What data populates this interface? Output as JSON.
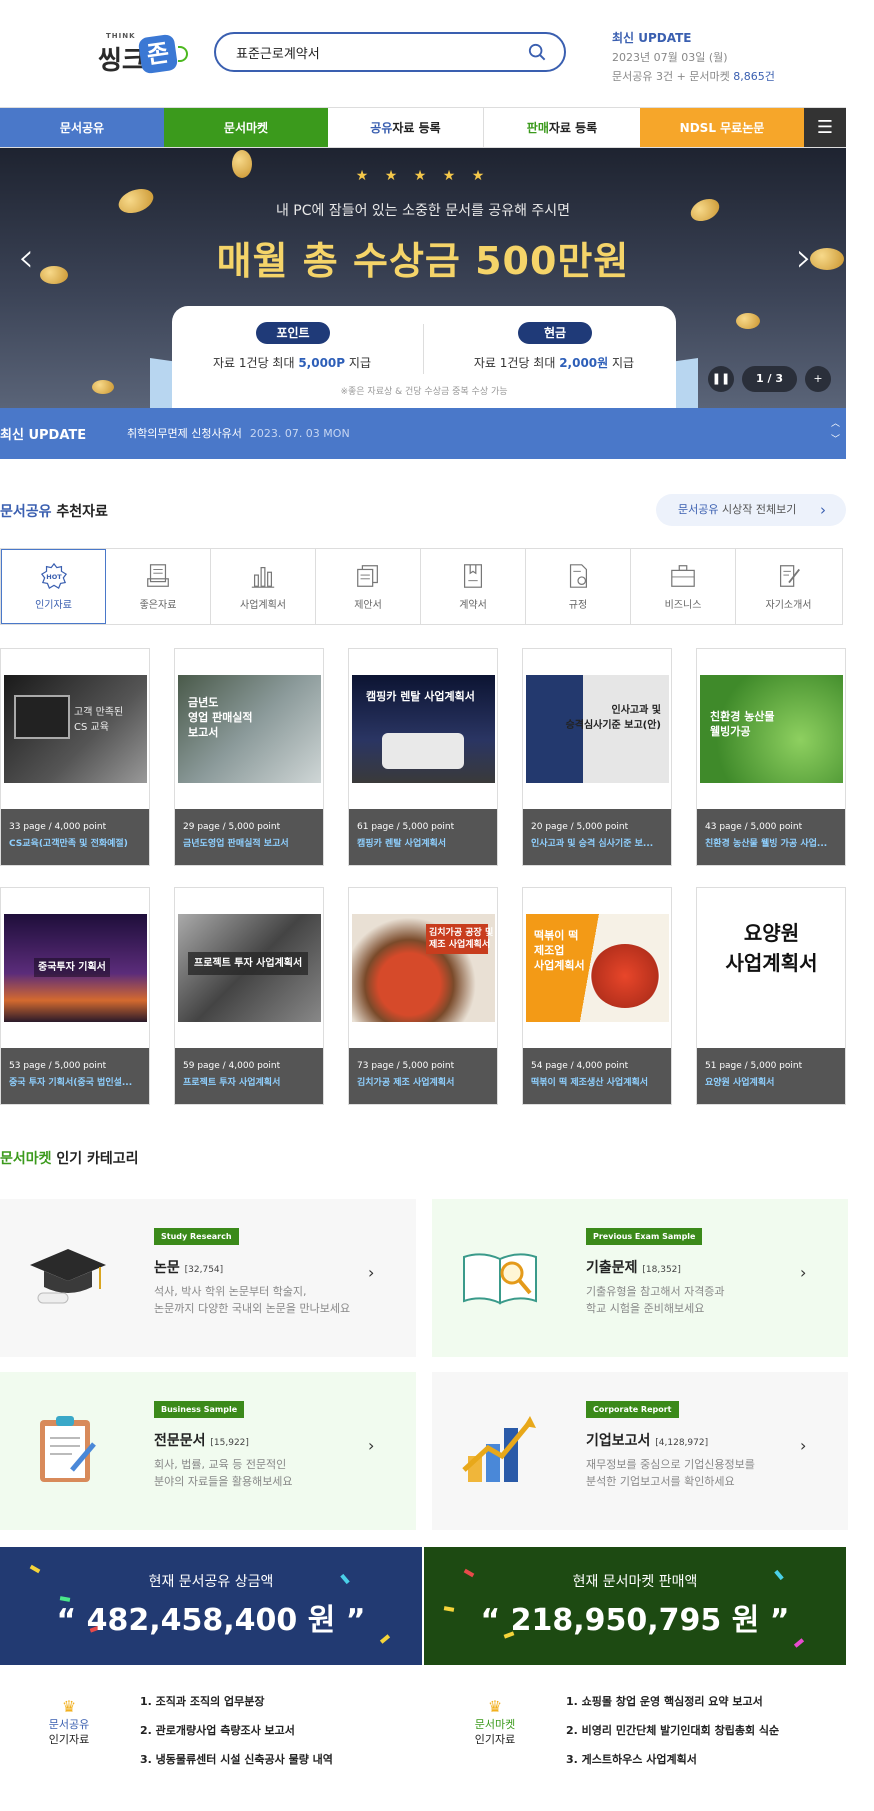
{
  "header": {
    "logo_small": "THINK",
    "logo_main": "씽크",
    "logo_badge": "존",
    "search_value": "표준근로계약서",
    "update_title": "최신 UPDATE",
    "update_date": "2023년 07월 03일 (월)",
    "update_count_prefix": "문서공유 3건 + 문서마켓 ",
    "update_count_value": "8,865건"
  },
  "nav": {
    "n1": "문서공유",
    "n2": "문서마켓",
    "n3_accent": "공유",
    "n3_rest": "자료 등록",
    "n4_accent": "판매",
    "n4_rest": "자료 등록",
    "n5": "NDSL 무료논문",
    "menu_icon": "hamburger-icon"
  },
  "banner": {
    "stars": "★ ★ ★ ★ ★",
    "subtitle": "내 PC에 잠들어 있는 소중한 문서를 공유해 주시면",
    "headline": "매월 총 수상금 500만원",
    "left_pill": "포인트",
    "left_text_a": "자료 1건당 최대 ",
    "left_text_b": "5,000P",
    "left_text_c": " 지급",
    "right_pill": "현금",
    "right_text_a": "자료 1건당 최대 ",
    "right_text_b": "2,000원",
    "right_text_c": " 지급",
    "note": "※좋은 자료상 & 건당 수상금 중복 수상 가능",
    "page": "1 / 3",
    "pause": "❚❚",
    "plus": "+"
  },
  "update_bar": {
    "title": "최신 UPDATE",
    "item": "취학의무면제 신청사유서",
    "date": "2023. 07. 03 MON"
  },
  "recommend": {
    "title_accent": "문서공유",
    "title_rest": " 추천자료",
    "viewall_accent": "문서공유",
    "viewall_rest": " 시상작 전체보기",
    "tabs": [
      {
        "label": "인기자료",
        "icon": "hot-badge-icon"
      },
      {
        "label": "좋은자료",
        "icon": "document-tray-icon"
      },
      {
        "label": "사업계획서",
        "icon": "bar-chart-icon"
      },
      {
        "label": "제안서",
        "icon": "papers-icon"
      },
      {
        "label": "계약서",
        "icon": "contract-book-icon"
      },
      {
        "label": "규정",
        "icon": "regulation-doc-icon"
      },
      {
        "label": "비즈니스",
        "icon": "briefcase-icon"
      },
      {
        "label": "자기소개서",
        "icon": "pen-doc-icon"
      }
    ],
    "docs": [
      {
        "thumb": "고객 만족된\nCS 교육",
        "meta": "33 page / 4,000 point",
        "name": "CS교육(고객만족 및 전화예절)"
      },
      {
        "thumb": "금년도\n영업 판매실적\n보고서",
        "meta": "29 page / 5,000 point",
        "name": "금년도영업 판매실적 보고서"
      },
      {
        "thumb": "캠핑카 렌탈 사업계획서",
        "meta": "61 page / 5,000 point",
        "name": "캠핑카 렌탈 사업계획서"
      },
      {
        "thumb": "인사고과 및\n승격심사기준 보고(안)",
        "meta": "20 page / 5,000 point",
        "name": "인사고과 및 승격 심사기준 보..."
      },
      {
        "thumb": "친환경 농산물\n웰빙가공",
        "meta": "43 page / 5,000 point",
        "name": "친환경 농산물 웰빙 가공 사업..."
      },
      {
        "thumb": "중국투자 기획서",
        "meta": "53 page / 5,000 point",
        "name": "중국 투자 기획서(중국 법인설..."
      },
      {
        "thumb": "프로젝트 투자 사업계획서",
        "meta": "59 page / 4,000 point",
        "name": "프로젝트 투자 사업계획서"
      },
      {
        "thumb": "김치가공 공장 및\n제조 사업계획서",
        "meta": "73 page / 5,000 point",
        "name": "김치가공 제조 사업계획서"
      },
      {
        "thumb": "떡볶이 떡\n제조업\n사업계획서",
        "meta": "54 page / 4,000 point",
        "name": "떡볶이 떡 제조생산 사업계획서"
      },
      {
        "thumb": "요양원\n사업계획서",
        "meta": "51 page / 5,000 point",
        "name": "요양원 사업계획서"
      }
    ]
  },
  "market": {
    "title_accent": "문서마켓",
    "title_rest": " 인기 카테고리",
    "cards": [
      {
        "badge": "Study Research",
        "name": "논문",
        "count": "[32,754]",
        "desc1": "석사, 박사 학위 논문부터 학술지,",
        "desc2": "논문까지 다양한 국내외 논문을 만나보세요",
        "icon": "graduation-cap-icon",
        "bg": "#f7f7f7"
      },
      {
        "badge": "Previous Exam Sample",
        "name": "기출문제",
        "count": "[18,352]",
        "desc1": "기출유형을 참고해서 자격증과",
        "desc2": "학교 시험을 준비해보세요",
        "icon": "book-magnifier-icon",
        "bg": "#f1fbef"
      },
      {
        "badge": "Business Sample",
        "name": "전문문서",
        "count": "[15,922]",
        "desc1": "회사, 법률, 교육 등 전문적인",
        "desc2": "분야의 자료들을 활용해보세요",
        "icon": "clipboard-icon",
        "bg": "#f1fbef"
      },
      {
        "badge": "Corporate Report",
        "name": "기업보고서",
        "count": "[4,128,972]",
        "desc1": "재무정보를 중심으로 기업신용정보를",
        "desc2": "분석한 기업보고서를 확인하세요",
        "icon": "growth-chart-icon",
        "bg": "#f7f7f7"
      }
    ]
  },
  "totals": {
    "share_label": "현재 문서공유 상금액",
    "share_value": "“ 482,458,400 원 ”",
    "market_label": "현재 문서마켓 판매액",
    "market_value": "“ 218,950,795 원 ”"
  },
  "popular": {
    "share_l1": "문서공유",
    "share_l2": "인기자료",
    "share_items": [
      "1. 조직과 조직의 업무분장",
      "2. 관로개량사업 측량조사 보고서",
      "3. 냉동물류센터 시설 신축공사 물량 내역"
    ],
    "market_l1": "문서마켓",
    "market_l2": "인기자료",
    "market_items": [
      "1. 쇼핑몰 창업 운영 핵심정리 요약 보고서",
      "2. 비영리 민간단체 발기인대회 창립총회 식순",
      "3. 게스트하우스 사업계획서"
    ]
  },
  "colors": {
    "blue": "#4a78c9",
    "green": "#3b9a1c",
    "orange": "#f6a62a",
    "navy": "#1f3a78"
  }
}
